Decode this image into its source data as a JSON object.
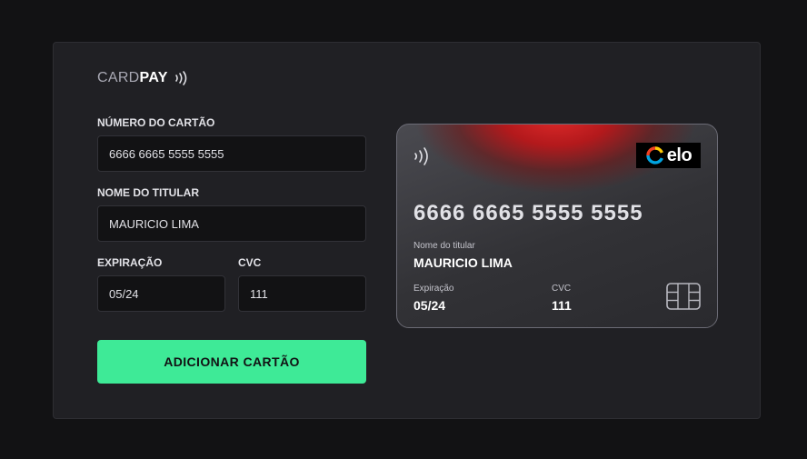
{
  "logo": {
    "part1": "CARD",
    "part2": "PAY"
  },
  "form": {
    "card_number_label": "NÚMERO DO CARTÃO",
    "card_number_value": "6666 6665 5555 5555",
    "holder_label": "NOME DO TITULAR",
    "holder_value": "MAURICIO LIMA",
    "expiration_label": "EXPIRAÇÃO",
    "expiration_value": "05/24",
    "cvc_label": "CVC",
    "cvc_value": "111",
    "submit_label": "ADICIONAR CARTÃO"
  },
  "card_preview": {
    "number": "6666 6665 5555 5555",
    "holder_label": "Nome do titular",
    "holder": "MAURICIO LIMA",
    "expiration_label": "Expiração",
    "expiration": "05/24",
    "cvc_label": "CVC",
    "cvc": "111",
    "brand": "elo"
  },
  "icons": {
    "contactless": "contactless-icon",
    "brand": "elo-logo",
    "chip": "chip-icon"
  },
  "colors": {
    "background": "#121214",
    "panel": "#202024",
    "input": "#121214",
    "accent": "#3eea97",
    "card_glow": "#e02a2a"
  }
}
